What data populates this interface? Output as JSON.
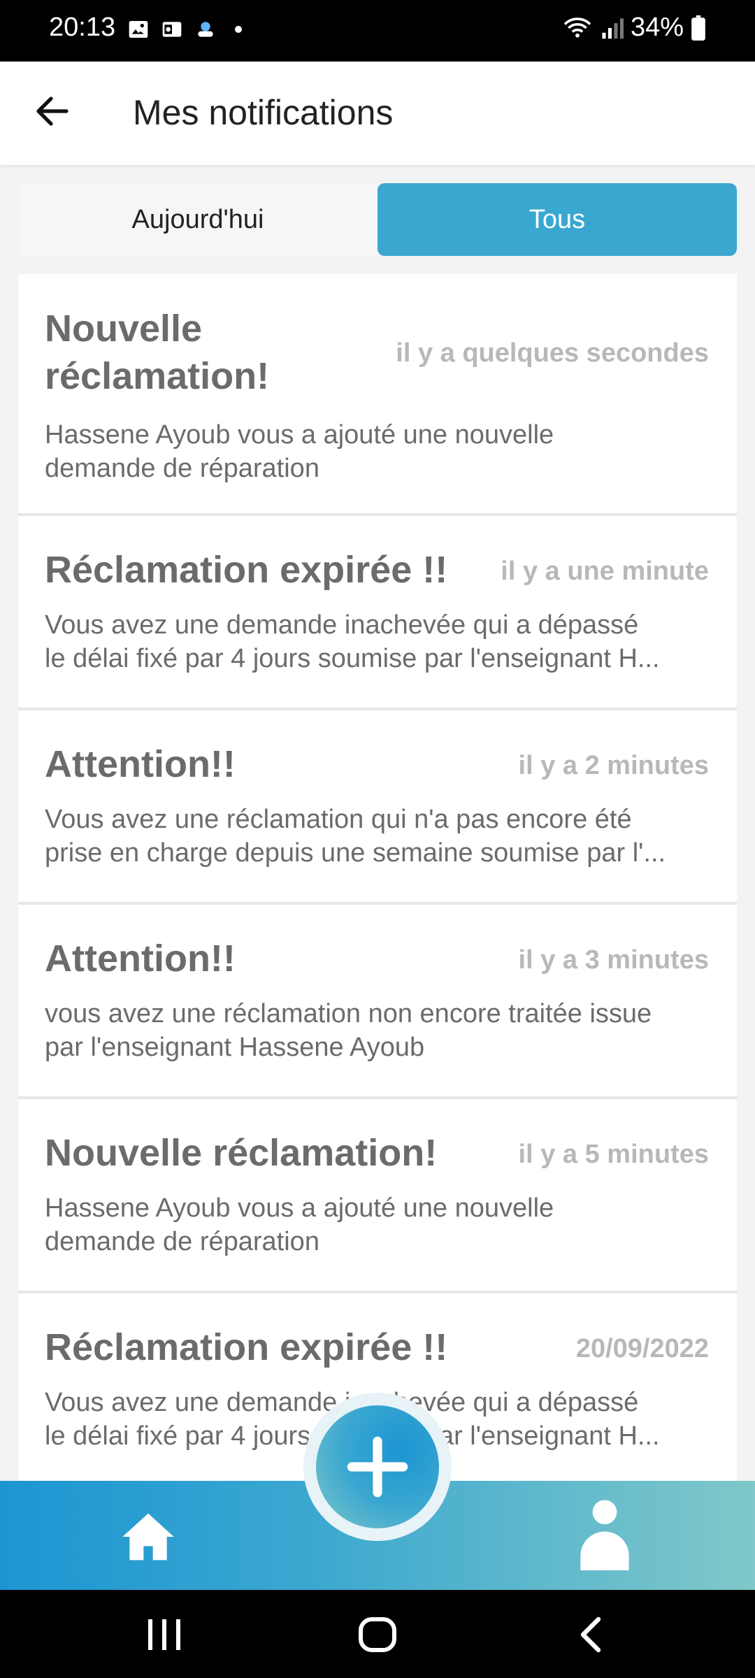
{
  "status_bar": {
    "time": "20:13",
    "battery": "34%",
    "icons": [
      "image-icon",
      "outlook-icon",
      "cloud-icon",
      "dot-icon",
      "wifi-icon",
      "signal-icon",
      "battery-icon"
    ]
  },
  "header": {
    "title": "Mes notifications",
    "back_icon": "arrow-left-icon"
  },
  "tabs": [
    {
      "label": "Aujourd'hui",
      "active": false
    },
    {
      "label": "Tous",
      "active": true
    }
  ],
  "notifications": [
    {
      "title_lines": [
        "Nouvelle",
        "réclamation!"
      ],
      "time": "il y a quelques secondes",
      "body_lines": [
        "Hassene Ayoub vous a ajouté une nouvelle",
        "demande de réparation"
      ]
    },
    {
      "title_lines": [
        "Réclamation expirée !!"
      ],
      "time": "il y a une minute",
      "body_lines": [
        "Vous avez une demande inachevée qui a dépassé",
        "le délai fixé par 4 jours soumise par l'enseignant H..."
      ]
    },
    {
      "title_lines": [
        "Attention!!"
      ],
      "time": "il y a 2 minutes",
      "body_lines": [
        "Vous avez une réclamation qui n'a pas encore été",
        "prise en charge depuis une semaine soumise par l'..."
      ]
    },
    {
      "title_lines": [
        "Attention!!"
      ],
      "time": "il y a 3 minutes",
      "body_lines": [
        "vous avez une réclamation non encore traitée issue",
        "par l'enseignant Hassene Ayoub"
      ]
    },
    {
      "title_lines": [
        "Nouvelle réclamation!"
      ],
      "time": "il y a 5 minutes",
      "body_lines": [
        "Hassene Ayoub vous a ajouté une nouvelle",
        "demande de réparation"
      ]
    },
    {
      "title_lines": [
        "Réclamation expirée !!"
      ],
      "time": "20/09/2022",
      "body_lines": [
        "Vous avez une demande inachevée qui a dépassé",
        "le délai fixé par 4 jours soumise par l'enseignant H..."
      ]
    }
  ],
  "bottom_nav": {
    "items": [
      "home-icon",
      "plus-icon",
      "profile-icon"
    ],
    "accent": "#3aa7d0"
  },
  "system_nav": [
    "recents-icon",
    "home-circle-icon",
    "back-chevron-icon"
  ]
}
